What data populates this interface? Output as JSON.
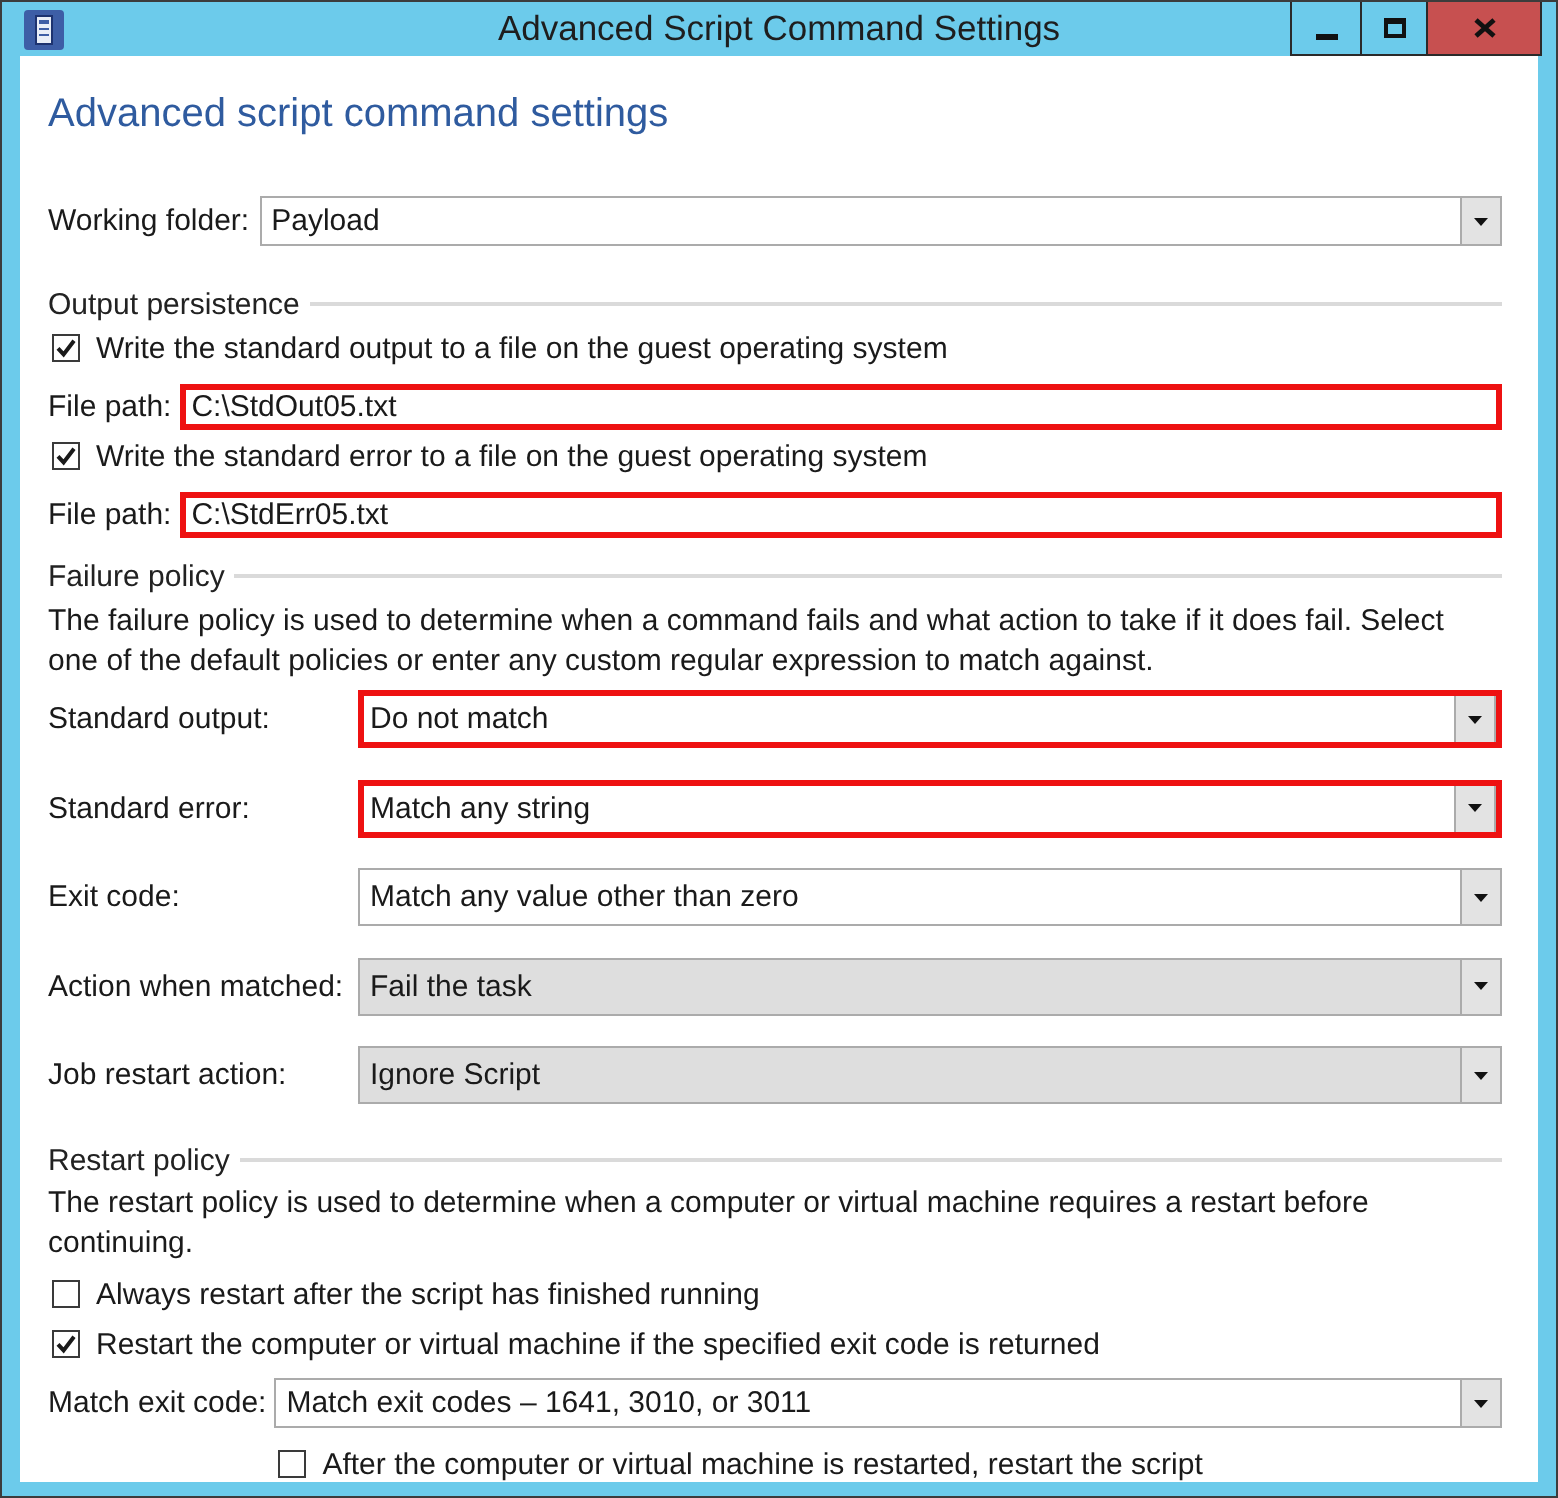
{
  "window": {
    "title": "Advanced Script Command Settings"
  },
  "heading": "Advanced script command settings",
  "working_folder": {
    "label": "Working folder:",
    "value": "Payload"
  },
  "output_persistence": {
    "title": "Output persistence",
    "items": [
      {
        "kind": "checkbox",
        "label": "Write the standard output to a file on the guest operating system",
        "checked": true
      },
      {
        "kind": "field",
        "label": "File path:",
        "value": "C:\\StdOut05.txt",
        "highlighted": true
      },
      {
        "kind": "checkbox",
        "label": "Write the standard error to a file on the guest operating system",
        "checked": true
      },
      {
        "kind": "field",
        "label": "File path:",
        "value": "C:\\StdErr05.txt",
        "highlighted": true
      }
    ]
  },
  "failure_policy": {
    "title": "Failure policy",
    "description": "The failure policy is used to determine when a command fails and what action to take if it does fail. Select one of the default policies or enter any custom regular expression to match against.",
    "rows": [
      {
        "label": "Standard output:",
        "value": "Do not match",
        "highlighted": true,
        "editable": true
      },
      {
        "label": "Standard error:",
        "value": "Match any string",
        "highlighted": true,
        "editable": true
      },
      {
        "label": "Exit code:",
        "value": "Match any value other than zero",
        "highlighted": false,
        "editable": true
      },
      {
        "label": "Action when matched:",
        "value": "Fail the task",
        "highlighted": false,
        "editable": false
      },
      {
        "label": "Job restart action:",
        "value": "Ignore Script",
        "highlighted": false,
        "editable": false
      }
    ]
  },
  "restart_policy": {
    "title": "Restart policy",
    "description": "The restart policy is used to determine when a computer or virtual machine requires a restart before continuing.",
    "items": [
      {
        "kind": "checkbox",
        "label": "Always restart after the script has finished running",
        "checked": false
      },
      {
        "kind": "checkbox",
        "label": "Restart the computer or virtual machine if the specified exit code is returned",
        "checked": true
      },
      {
        "kind": "dropdown",
        "label": "Match exit code:",
        "value": "Match exit codes – 1641, 3010, or 3011",
        "children": [
          {
            "kind": "checkbox",
            "label": "After the computer or virtual machine is restarted, restart the script",
            "checked": false
          }
        ]
      }
    ]
  }
}
